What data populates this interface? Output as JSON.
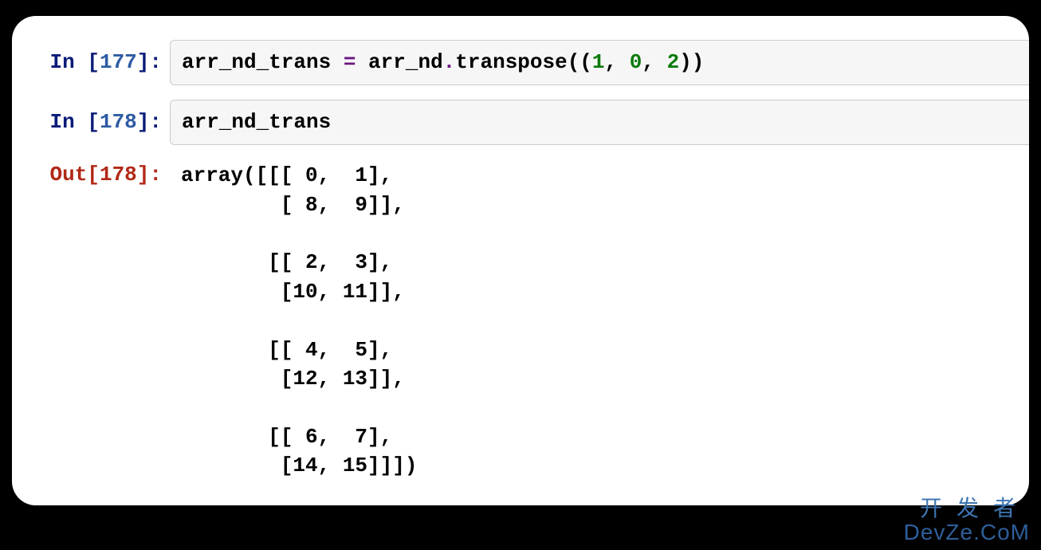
{
  "cells": [
    {
      "type": "code",
      "prompt_label": "In ",
      "exec_count": 177,
      "tokens": [
        {
          "t": "arr_nd_trans ",
          "c": "tok-name"
        },
        {
          "t": "=",
          "c": "tok-op"
        },
        {
          "t": " arr_nd",
          "c": "tok-name"
        },
        {
          "t": ".",
          "c": "tok-op"
        },
        {
          "t": "transpose((",
          "c": "tok-name"
        },
        {
          "t": "1",
          "c": "tok-num"
        },
        {
          "t": ", ",
          "c": "tok-name"
        },
        {
          "t": "0",
          "c": "tok-num"
        },
        {
          "t": ", ",
          "c": "tok-name"
        },
        {
          "t": "2",
          "c": "tok-num"
        },
        {
          "t": "))",
          "c": "tok-name"
        }
      ]
    },
    {
      "type": "code",
      "prompt_label": "In ",
      "exec_count": 178,
      "tokens": [
        {
          "t": "arr_nd_trans",
          "c": "tok-name"
        }
      ]
    },
    {
      "type": "output",
      "prompt_label": "Out",
      "exec_count": 178,
      "text": "array([[[ 0,  1],\n        [ 8,  9]],\n\n       [[ 2,  3],\n        [10, 11]],\n\n       [[ 4,  5],\n        [12, 13]],\n\n       [[ 6,  7],\n        [14, 15]]])"
    }
  ],
  "watermark": {
    "line1": "开发者",
    "line2": "DevZe.CoM"
  }
}
